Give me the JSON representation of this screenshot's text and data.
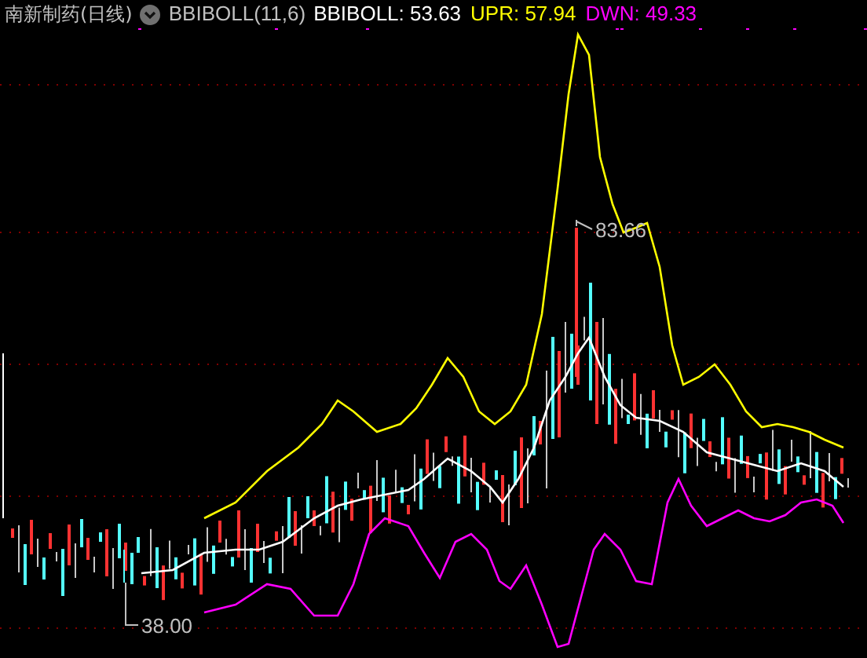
{
  "header": {
    "title": "南新制药(日线)",
    "indicator": "BBIBOLL(11,6)",
    "values": [
      {
        "text": "BBIBOLL: 53.63",
        "color": "#ffffff"
      },
      {
        "text": "UPR: 57.94",
        "color": "#ffff00"
      },
      {
        "text": "DWN: 49.33",
        "color": "#ff00ff"
      }
    ]
  },
  "chart": {
    "high_label": "83.66",
    "low_label": "38.00"
  }
}
